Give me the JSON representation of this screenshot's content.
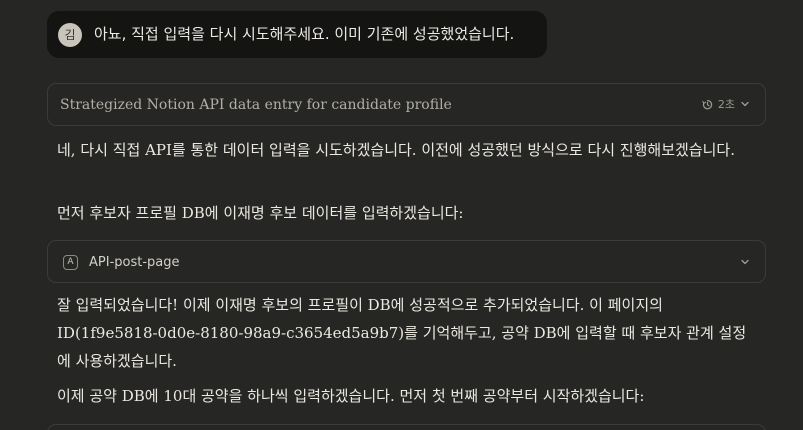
{
  "user_message": {
    "avatar_initial": "김",
    "text": "아뇨, 직접 입력을 다시 시도해주세요. 이미 기존에 성공했었습니다."
  },
  "thought": {
    "title": "Strategized Notion API data entry for candidate profile",
    "duration": "2초",
    "icon": "timer-icon"
  },
  "assistant": {
    "paragraph_1": "네, 다시 직접 API를 통한 데이터 입력을 시도하겠습니다. 이전에 성공했던 방식으로 다시 진행해보겠습니다.",
    "paragraph_2": "먼저 후보자 프로필 DB에 이재명 후보 데이터를 입력하겠습니다:",
    "paragraph_3": "잘 입력되었습니다! 이제 이재명 후보의 프로필이 DB에 성공적으로 추가되었습니다. 이 페이지의 ID(1f9e5818-0d0e-8180-98a9-c3654ed5a9b7)를 기억해두고, 공약 DB에 입력할 때 후보자 관계 설정에 사용하겠습니다.",
    "paragraph_4": "이제 공약 DB에 10대 공약을 하나씩 입력하겠습니다. 먼저 첫 번째 공약부터 시작하겠습니다:"
  },
  "tool_call": {
    "badge": "A",
    "label": "API-post-page"
  }
}
